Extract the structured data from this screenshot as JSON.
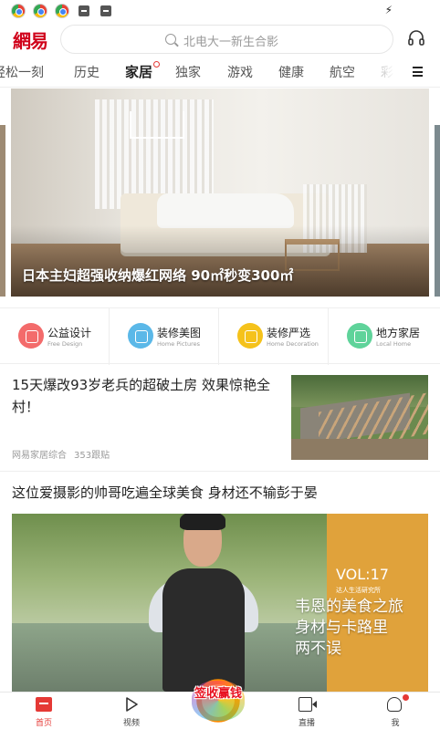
{
  "header": {
    "logo": "網易",
    "search_placeholder": "北电大一新生合影"
  },
  "tabs": [
    {
      "label": "轻松一刻"
    },
    {
      "label": "历史"
    },
    {
      "label": "家居",
      "active": true
    },
    {
      "label": "独家"
    },
    {
      "label": "游戏"
    },
    {
      "label": "健康"
    },
    {
      "label": "航空"
    },
    {
      "label": "彩"
    }
  ],
  "banner": {
    "caption": "日本主妇超强收纳爆红网络 90㎡秒变300㎡"
  },
  "shortcuts": [
    {
      "title": "公益设计",
      "subtitle": "Free Design",
      "color": "#f36b6b"
    },
    {
      "title": "装修美图",
      "subtitle": "Home Pictures",
      "color": "#5bb8e8"
    },
    {
      "title": "装修严选",
      "subtitle": "Home Decoration",
      "color": "#f5c21b"
    },
    {
      "title": "地方家居",
      "subtitle": "Local Home",
      "color": "#5fd39a"
    }
  ],
  "articles": [
    {
      "title": "15天爆改93岁老兵的超破土房 效果惊艳全村！",
      "source": "网易家居综合",
      "comments": "353跟贴"
    },
    {
      "title": "这位爱摄影的帅哥吃遍全球美食 身材还不输彭于晏",
      "image_vol": "VOL:17",
      "image_sub": "达人生活研究所",
      "image_line1": "韦恩的美食之旅",
      "image_line2": "身材与卡路里",
      "image_line3": "两不误"
    }
  ],
  "promo": {
    "text": "签收赢钱"
  },
  "bottom_nav": [
    {
      "label": "首页",
      "active": true,
      "icon": "home-icon"
    },
    {
      "label": "视频",
      "icon": "video-icon"
    },
    {
      "label": "直播",
      "icon": "live-icon"
    },
    {
      "label": "我",
      "icon": "profile-icon"
    }
  ],
  "colors": {
    "brand_red": "#d0021b",
    "accent_red": "#e53935"
  }
}
